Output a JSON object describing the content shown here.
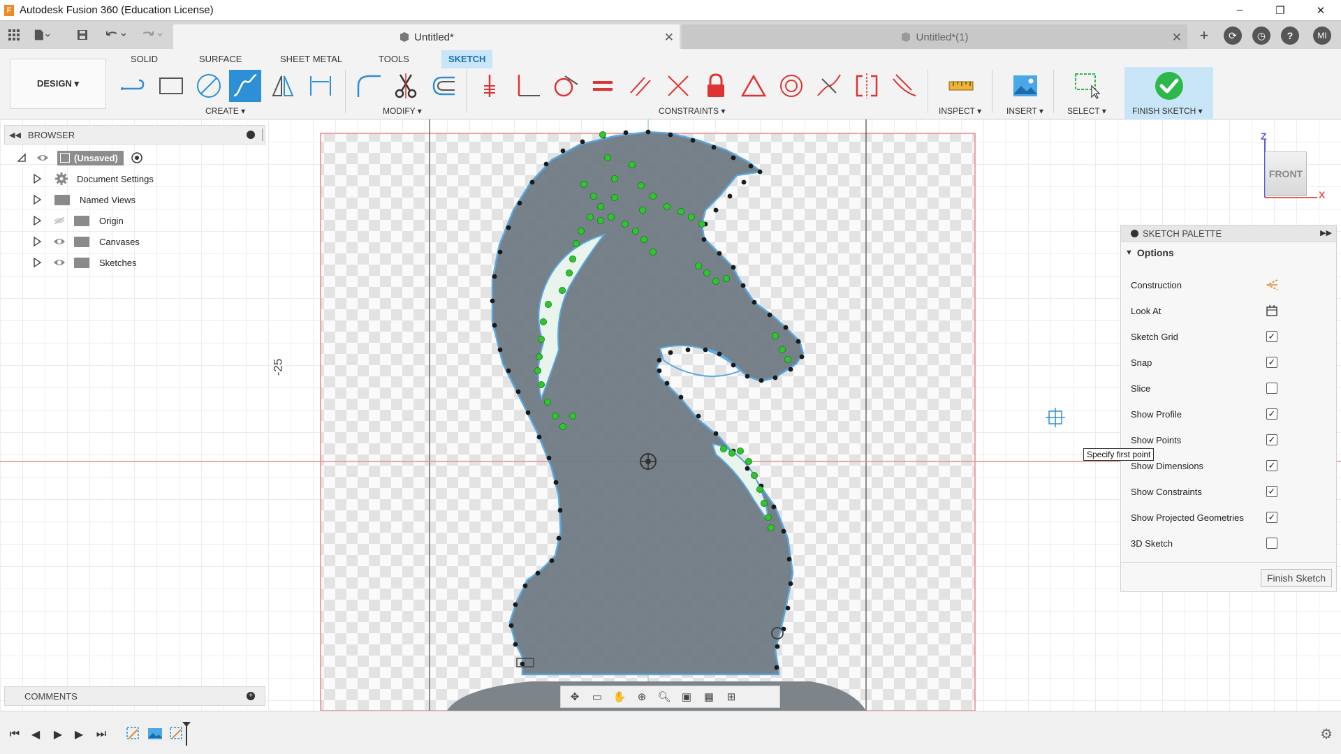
{
  "window": {
    "title": "Autodesk Fusion 360 (Education License)",
    "logo": "F",
    "controls": [
      "–",
      "❐",
      "✕"
    ]
  },
  "tabs": {
    "active": "Untitled*",
    "inactive": "Untitled*(1)"
  },
  "user": {
    "initials": "MI"
  },
  "ribbon": {
    "workspace": "DESIGN ▾",
    "tabs": [
      "SOLID",
      "SURFACE",
      "SHEET METAL",
      "TOOLS",
      "SKETCH"
    ],
    "groups": {
      "create": "CREATE ▾",
      "modify": "MODIFY ▾",
      "constraints": "CONSTRAINTS ▾",
      "inspect": "INSPECT ▾",
      "insert": "INSERT ▾",
      "select": "SELECT ▾",
      "finish": "FINISH SKETCH ▾"
    }
  },
  "browser": {
    "title": "BROWSER",
    "root": "(Unsaved)",
    "items": [
      "Document Settings",
      "Named Views",
      "Origin",
      "Canvases",
      "Sketches"
    ]
  },
  "comments": {
    "title": "COMMENTS"
  },
  "viewcube": {
    "face": "FRONT",
    "z": "Z",
    "x": "X"
  },
  "canvas": {
    "dimension": "-25",
    "tooltip": "Specify first point"
  },
  "palette": {
    "title": "SKETCH PALETTE",
    "section": "Options",
    "options": [
      {
        "label": "Construction",
        "kind": "icon",
        "icon": "construction-icon"
      },
      {
        "label": "Look At",
        "kind": "icon",
        "icon": "look-at-icon"
      },
      {
        "label": "Sketch Grid",
        "kind": "checkbox",
        "checked": true
      },
      {
        "label": "Snap",
        "kind": "checkbox",
        "checked": true
      },
      {
        "label": "Slice",
        "kind": "checkbox",
        "checked": false
      },
      {
        "label": "Show Profile",
        "kind": "checkbox",
        "checked": true
      },
      {
        "label": "Show Points",
        "kind": "checkbox",
        "checked": true
      },
      {
        "label": "Show Dimensions",
        "kind": "checkbox",
        "checked": true
      },
      {
        "label": "Show Constraints",
        "kind": "checkbox",
        "checked": true
      },
      {
        "label": "Show Projected Geometries",
        "kind": "checkbox",
        "checked": true
      },
      {
        "label": "3D Sketch",
        "kind": "checkbox",
        "checked": false
      }
    ],
    "finish_button": "Finish Sketch"
  },
  "colors": {
    "accent": "#2d8fd5",
    "sketch_fill": "#6f7a83",
    "constraint_green": "#2fc52f",
    "check_green": "#2db84b"
  }
}
